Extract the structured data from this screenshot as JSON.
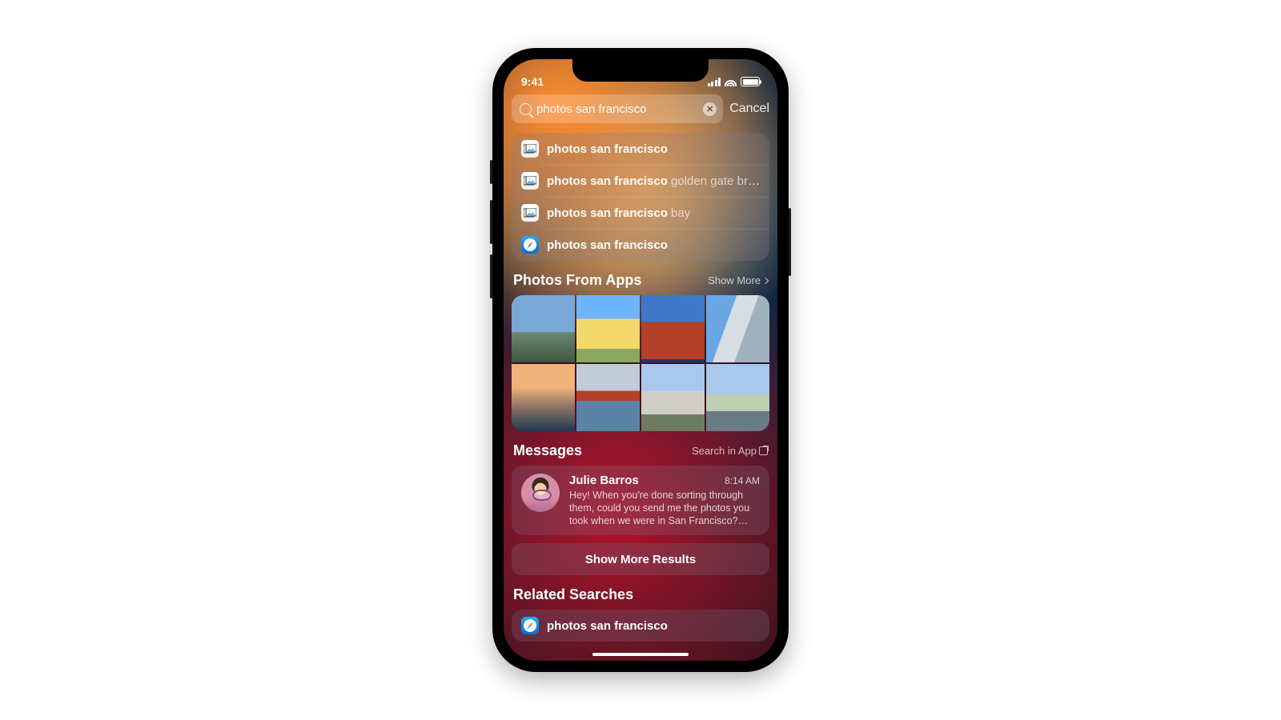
{
  "status": {
    "time": "9:41"
  },
  "search": {
    "query": "photos san francisco",
    "cancel": "Cancel"
  },
  "suggestions": [
    {
      "icon": "photos",
      "bold": "photos san francisco",
      "rest": ""
    },
    {
      "icon": "photos",
      "bold": "photos san francisco",
      "rest": " golden gate bridge"
    },
    {
      "icon": "photos",
      "bold": "photos san francisco",
      "rest": " bay"
    },
    {
      "icon": "safari",
      "bold": "photos san francisco",
      "rest": ""
    }
  ],
  "photos_section": {
    "title": "Photos From Apps",
    "action": "Show More"
  },
  "messages_section": {
    "title": "Messages",
    "action": "Search in App"
  },
  "message": {
    "name": "Julie Barros",
    "time": "8:14 AM",
    "text": "Hey! When you're done sorting through them, could you send me the photos you took when we were in San Francisco? Wa…"
  },
  "show_more_results": "Show More Results",
  "related_section": {
    "title": "Related Searches"
  },
  "related": [
    {
      "icon": "safari",
      "bold": "photos san francisco",
      "rest": ""
    }
  ]
}
